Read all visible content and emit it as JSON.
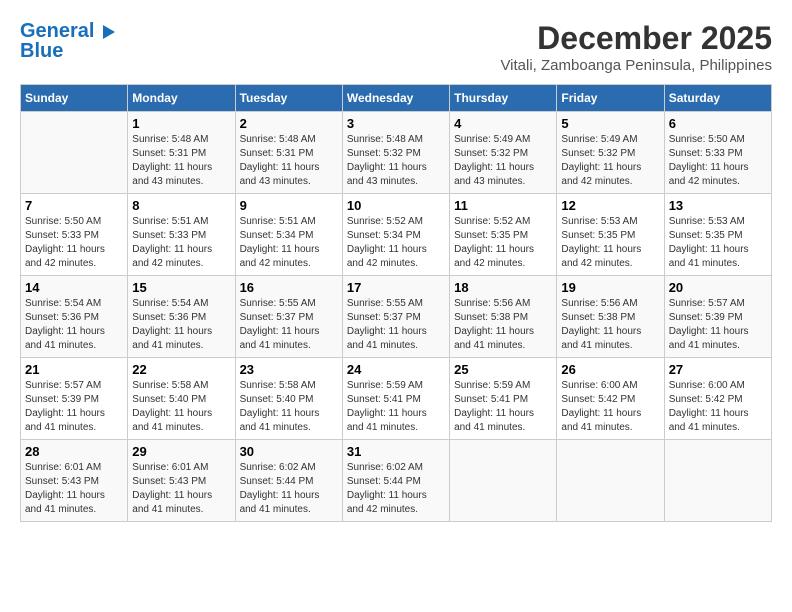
{
  "logo": {
    "line1": "General",
    "line2": "Blue"
  },
  "title": "December 2025",
  "subtitle": "Vitali, Zamboanga Peninsula, Philippines",
  "weekdays": [
    "Sunday",
    "Monday",
    "Tuesday",
    "Wednesday",
    "Thursday",
    "Friday",
    "Saturday"
  ],
  "weeks": [
    [
      {
        "day": "",
        "sunrise": "",
        "sunset": "",
        "daylight": ""
      },
      {
        "day": "1",
        "sunrise": "Sunrise: 5:48 AM",
        "sunset": "Sunset: 5:31 PM",
        "daylight": "Daylight: 11 hours and 43 minutes."
      },
      {
        "day": "2",
        "sunrise": "Sunrise: 5:48 AM",
        "sunset": "Sunset: 5:31 PM",
        "daylight": "Daylight: 11 hours and 43 minutes."
      },
      {
        "day": "3",
        "sunrise": "Sunrise: 5:48 AM",
        "sunset": "Sunset: 5:32 PM",
        "daylight": "Daylight: 11 hours and 43 minutes."
      },
      {
        "day": "4",
        "sunrise": "Sunrise: 5:49 AM",
        "sunset": "Sunset: 5:32 PM",
        "daylight": "Daylight: 11 hours and 43 minutes."
      },
      {
        "day": "5",
        "sunrise": "Sunrise: 5:49 AM",
        "sunset": "Sunset: 5:32 PM",
        "daylight": "Daylight: 11 hours and 42 minutes."
      },
      {
        "day": "6",
        "sunrise": "Sunrise: 5:50 AM",
        "sunset": "Sunset: 5:33 PM",
        "daylight": "Daylight: 11 hours and 42 minutes."
      }
    ],
    [
      {
        "day": "7",
        "sunrise": "Sunrise: 5:50 AM",
        "sunset": "Sunset: 5:33 PM",
        "daylight": "Daylight: 11 hours and 42 minutes."
      },
      {
        "day": "8",
        "sunrise": "Sunrise: 5:51 AM",
        "sunset": "Sunset: 5:33 PM",
        "daylight": "Daylight: 11 hours and 42 minutes."
      },
      {
        "day": "9",
        "sunrise": "Sunrise: 5:51 AM",
        "sunset": "Sunset: 5:34 PM",
        "daylight": "Daylight: 11 hours and 42 minutes."
      },
      {
        "day": "10",
        "sunrise": "Sunrise: 5:52 AM",
        "sunset": "Sunset: 5:34 PM",
        "daylight": "Daylight: 11 hours and 42 minutes."
      },
      {
        "day": "11",
        "sunrise": "Sunrise: 5:52 AM",
        "sunset": "Sunset: 5:35 PM",
        "daylight": "Daylight: 11 hours and 42 minutes."
      },
      {
        "day": "12",
        "sunrise": "Sunrise: 5:53 AM",
        "sunset": "Sunset: 5:35 PM",
        "daylight": "Daylight: 11 hours and 42 minutes."
      },
      {
        "day": "13",
        "sunrise": "Sunrise: 5:53 AM",
        "sunset": "Sunset: 5:35 PM",
        "daylight": "Daylight: 11 hours and 41 minutes."
      }
    ],
    [
      {
        "day": "14",
        "sunrise": "Sunrise: 5:54 AM",
        "sunset": "Sunset: 5:36 PM",
        "daylight": "Daylight: 11 hours and 41 minutes."
      },
      {
        "day": "15",
        "sunrise": "Sunrise: 5:54 AM",
        "sunset": "Sunset: 5:36 PM",
        "daylight": "Daylight: 11 hours and 41 minutes."
      },
      {
        "day": "16",
        "sunrise": "Sunrise: 5:55 AM",
        "sunset": "Sunset: 5:37 PM",
        "daylight": "Daylight: 11 hours and 41 minutes."
      },
      {
        "day": "17",
        "sunrise": "Sunrise: 5:55 AM",
        "sunset": "Sunset: 5:37 PM",
        "daylight": "Daylight: 11 hours and 41 minutes."
      },
      {
        "day": "18",
        "sunrise": "Sunrise: 5:56 AM",
        "sunset": "Sunset: 5:38 PM",
        "daylight": "Daylight: 11 hours and 41 minutes."
      },
      {
        "day": "19",
        "sunrise": "Sunrise: 5:56 AM",
        "sunset": "Sunset: 5:38 PM",
        "daylight": "Daylight: 11 hours and 41 minutes."
      },
      {
        "day": "20",
        "sunrise": "Sunrise: 5:57 AM",
        "sunset": "Sunset: 5:39 PM",
        "daylight": "Daylight: 11 hours and 41 minutes."
      }
    ],
    [
      {
        "day": "21",
        "sunrise": "Sunrise: 5:57 AM",
        "sunset": "Sunset: 5:39 PM",
        "daylight": "Daylight: 11 hours and 41 minutes."
      },
      {
        "day": "22",
        "sunrise": "Sunrise: 5:58 AM",
        "sunset": "Sunset: 5:40 PM",
        "daylight": "Daylight: 11 hours and 41 minutes."
      },
      {
        "day": "23",
        "sunrise": "Sunrise: 5:58 AM",
        "sunset": "Sunset: 5:40 PM",
        "daylight": "Daylight: 11 hours and 41 minutes."
      },
      {
        "day": "24",
        "sunrise": "Sunrise: 5:59 AM",
        "sunset": "Sunset: 5:41 PM",
        "daylight": "Daylight: 11 hours and 41 minutes."
      },
      {
        "day": "25",
        "sunrise": "Sunrise: 5:59 AM",
        "sunset": "Sunset: 5:41 PM",
        "daylight": "Daylight: 11 hours and 41 minutes."
      },
      {
        "day": "26",
        "sunrise": "Sunrise: 6:00 AM",
        "sunset": "Sunset: 5:42 PM",
        "daylight": "Daylight: 11 hours and 41 minutes."
      },
      {
        "day": "27",
        "sunrise": "Sunrise: 6:00 AM",
        "sunset": "Sunset: 5:42 PM",
        "daylight": "Daylight: 11 hours and 41 minutes."
      }
    ],
    [
      {
        "day": "28",
        "sunrise": "Sunrise: 6:01 AM",
        "sunset": "Sunset: 5:43 PM",
        "daylight": "Daylight: 11 hours and 41 minutes."
      },
      {
        "day": "29",
        "sunrise": "Sunrise: 6:01 AM",
        "sunset": "Sunset: 5:43 PM",
        "daylight": "Daylight: 11 hours and 41 minutes."
      },
      {
        "day": "30",
        "sunrise": "Sunrise: 6:02 AM",
        "sunset": "Sunset: 5:44 PM",
        "daylight": "Daylight: 11 hours and 41 minutes."
      },
      {
        "day": "31",
        "sunrise": "Sunrise: 6:02 AM",
        "sunset": "Sunset: 5:44 PM",
        "daylight": "Daylight: 11 hours and 42 minutes."
      },
      {
        "day": "",
        "sunrise": "",
        "sunset": "",
        "daylight": ""
      },
      {
        "day": "",
        "sunrise": "",
        "sunset": "",
        "daylight": ""
      },
      {
        "day": "",
        "sunrise": "",
        "sunset": "",
        "daylight": ""
      }
    ]
  ]
}
